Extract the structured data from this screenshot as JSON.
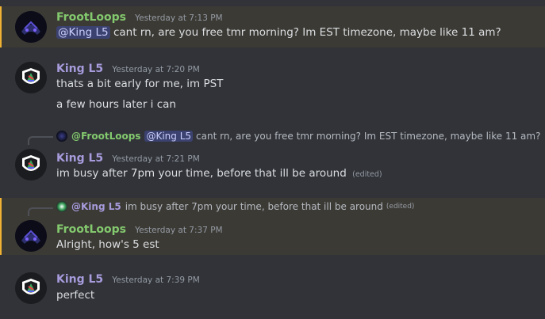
{
  "messages": [
    {
      "author": "FrootLoops",
      "timestamp": "Yesterday at 7:13 PM",
      "mention": "@King L5",
      "text": "cant rn, are you free tmr morning? Im EST timezone, maybe like 11 am?"
    },
    {
      "author": "King L5",
      "timestamp": "Yesterday at 7:20 PM",
      "lines": [
        "thats a bit early for me, im PST",
        "a few hours later i can"
      ]
    },
    {
      "reply": {
        "author": "@FrootLoops",
        "mention": "@King L5",
        "text": "cant rn, are you free tmr morning? Im EST timezone, maybe like 11 am?"
      },
      "author": "King L5",
      "timestamp": "Yesterday at 7:21 PM",
      "text": "im busy after 7pm your time, before that ill be around",
      "edited": "(edited)"
    },
    {
      "reply": {
        "author": "@King L5",
        "text": "im busy after 7pm your time, before that ill be around",
        "edited": "(edited)"
      },
      "author": "FrootLoops",
      "timestamp": "Yesterday at 7:37 PM",
      "text": "Alright, how's 5 est"
    },
    {
      "author": "King L5",
      "timestamp": "Yesterday at 7:39 PM",
      "text": "perfect"
    }
  ],
  "colors": {
    "background": "#313338",
    "highlight_bg": "#3c3a35",
    "highlight_bar": "#f0b232",
    "froot_name": "#83c96e",
    "king_name": "#a79bdc",
    "mention_bg": "#3c4270",
    "mention_fg": "#c9cdfb",
    "timestamp": "#949ba4"
  },
  "icons": {
    "froot_avatar": "froot-loops-avatar",
    "king_avatar": "king-l5-avatar"
  }
}
